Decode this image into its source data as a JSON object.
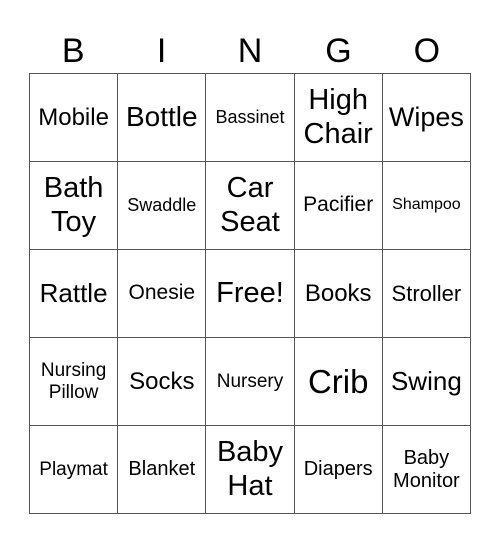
{
  "header": [
    "B",
    "I",
    "N",
    "G",
    "O"
  ],
  "cells": [
    {
      "text": "Mobile",
      "size": 24
    },
    {
      "text": "Bottle",
      "size": 28
    },
    {
      "text": "Bassinet",
      "size": 18
    },
    {
      "text": "High Chair",
      "size": 29
    },
    {
      "text": "Wipes",
      "size": 27
    },
    {
      "text": "Bath Toy",
      "size": 29
    },
    {
      "text": "Swaddle",
      "size": 18
    },
    {
      "text": "Car Seat",
      "size": 29
    },
    {
      "text": "Pacifier",
      "size": 21
    },
    {
      "text": "Shampoo",
      "size": 16
    },
    {
      "text": "Rattle",
      "size": 26
    },
    {
      "text": "Onesie",
      "size": 21
    },
    {
      "text": "Free!",
      "size": 29
    },
    {
      "text": "Books",
      "size": 24
    },
    {
      "text": "Stroller",
      "size": 22
    },
    {
      "text": "Nursing Pillow",
      "size": 19
    },
    {
      "text": "Socks",
      "size": 24
    },
    {
      "text": "Nursery",
      "size": 19
    },
    {
      "text": "Crib",
      "size": 33
    },
    {
      "text": "Swing",
      "size": 26
    },
    {
      "text": "Playmat",
      "size": 19
    },
    {
      "text": "Blanket",
      "size": 20
    },
    {
      "text": "Baby Hat",
      "size": 29
    },
    {
      "text": "Diapers",
      "size": 20
    },
    {
      "text": "Baby Monitor",
      "size": 20
    }
  ]
}
